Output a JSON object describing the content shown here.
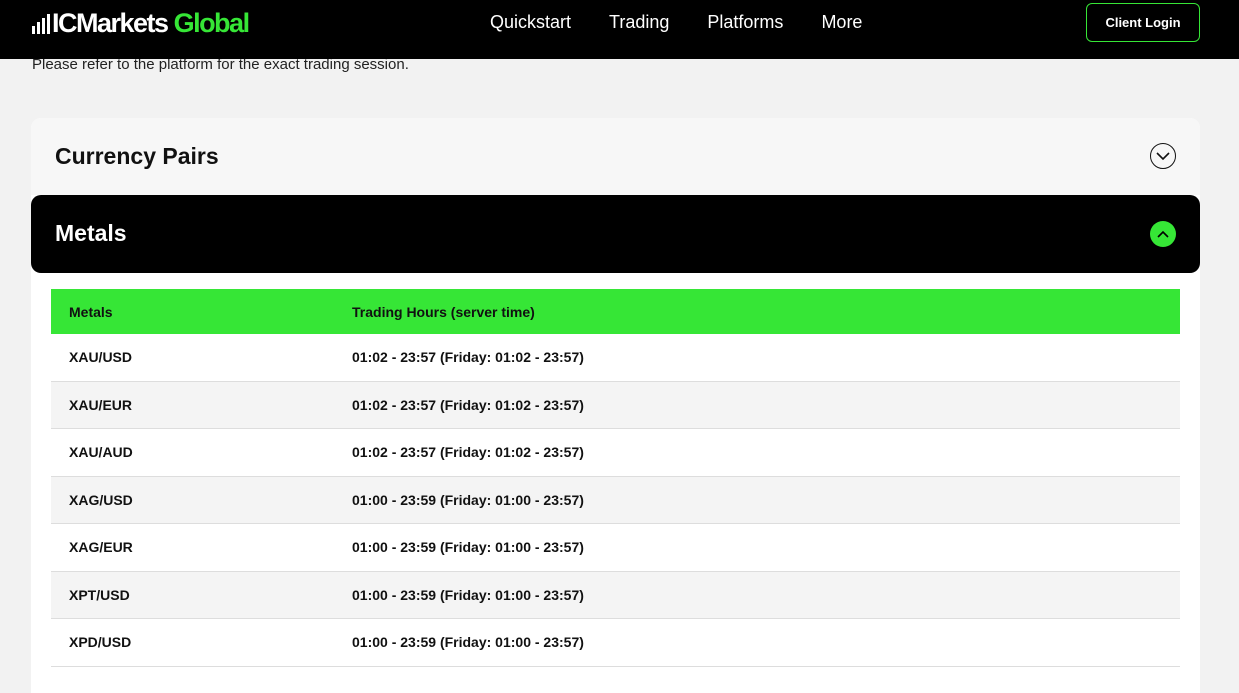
{
  "header": {
    "logo": {
      "ic": "IC",
      "markets": "Markets",
      "global": "Global"
    },
    "nav": [
      "Quickstart",
      "Trading",
      "Platforms",
      "More"
    ],
    "login_label": "Client Login"
  },
  "notice": "Please refer to the platform for the exact trading session.",
  "accordion": {
    "currency_title": "Currency Pairs",
    "metals_title": "Metals"
  },
  "table": {
    "headers": [
      "Metals",
      "Trading Hours (server time)"
    ],
    "rows": [
      [
        "XAU/USD",
        "01:02 - 23:57 (Friday: 01:02 - 23:57)"
      ],
      [
        "XAU/EUR",
        "01:02 - 23:57 (Friday: 01:02 - 23:57)"
      ],
      [
        "XAU/AUD",
        "01:02 - 23:57 (Friday: 01:02 - 23:57)"
      ],
      [
        "XAG/USD",
        "01:00 - 23:59 (Friday: 01:00 - 23:57)"
      ],
      [
        "XAG/EUR",
        "01:00 - 23:59 (Friday: 01:00 - 23:57)"
      ],
      [
        "XPT/USD",
        "01:00 - 23:59 (Friday: 01:00 - 23:57)"
      ],
      [
        "XPD/USD",
        "01:00 - 23:59 (Friday: 01:00 - 23:57)"
      ]
    ]
  },
  "colors": {
    "brand_green": "#36e636",
    "header_bg": "#000000"
  }
}
